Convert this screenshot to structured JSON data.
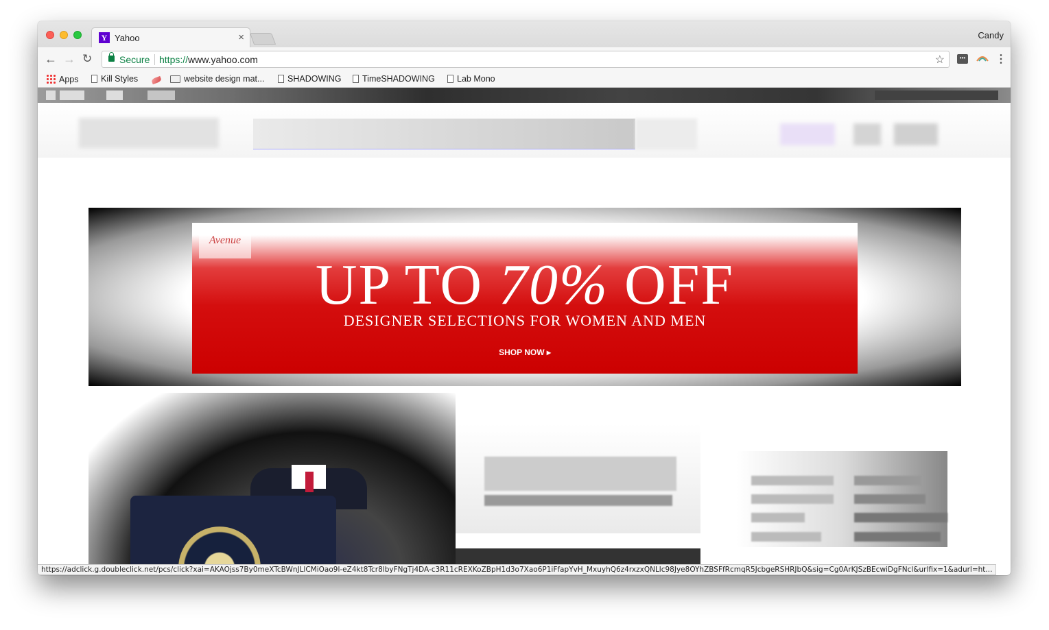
{
  "browser": {
    "tab": {
      "title": "Yahoo",
      "favicon": "Y",
      "close": "×"
    },
    "profile_name": "Candy",
    "nav": {
      "back": "←",
      "forward": "→",
      "reload": "↻"
    },
    "omnibox": {
      "secure_label": "Secure",
      "url_scheme": "https://",
      "url_host": "www.yahoo.com",
      "star": "☆"
    },
    "menu": "⋮",
    "bookmarks": [
      {
        "label": "Apps",
        "icon": "apps-icon"
      },
      {
        "label": "Kill Styles",
        "icon": "doc-icon"
      },
      {
        "label": "",
        "icon": "feather-icon"
      },
      {
        "label": "website design mat...",
        "icon": "folder-icon"
      },
      {
        "label": "SHADOWING",
        "icon": "doc-icon"
      },
      {
        "label": "TimeSHADOWING",
        "icon": "doc-icon"
      },
      {
        "label": "Lab Mono",
        "icon": "doc-icon"
      }
    ]
  },
  "ad": {
    "logo_text": "Avenue",
    "headline_pre": "UP TO ",
    "headline_pct": "70%",
    "headline_post": " OFF",
    "subline": "DESIGNER SELECTIONS FOR WOMEN AND MEN",
    "cta": "SHOP NOW ▸",
    "colors": {
      "banner": "#cc0000",
      "text": "#ffffff"
    }
  },
  "status_url": "https://adclick.g.doubleclick.net/pcs/click?xai=AKAOjss7By0meXTcBWnJLlCMiOao9l-eZ4kt8Tcr8lbyFNgTj4DA-c3R11cREXKoZBpH1d3o7Xao6P1iFfapYvH_MxuyhQ6z4rxzxQNLlc98Jye8OYhZBSFfRcmqR5JcbgeRSHRJbQ&sig=Cg0ArKJSzBEcwiDgFNcl&urlfix=1&adurl=ht..."
}
